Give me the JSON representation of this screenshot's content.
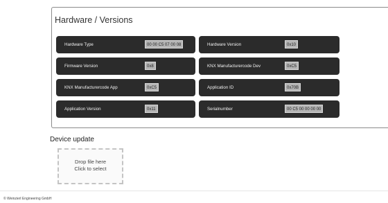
{
  "hardware_panel": {
    "title": "Hardware / Versions",
    "items": [
      {
        "label": "Hardware Type",
        "value": "00 00 C5 07 00 08"
      },
      {
        "label": "Hardware Version",
        "value": "0x10"
      },
      {
        "label": "Firmware Version",
        "value": "0x8"
      },
      {
        "label": "KNX Manufacturercode Dev",
        "value": "0xC5"
      },
      {
        "label": "KNX Manufacturercode App",
        "value": "0xC5"
      },
      {
        "label": "Application ID",
        "value": "0x70B"
      },
      {
        "label": "Application Version",
        "value": "0x11"
      },
      {
        "label": "Serialnumber",
        "value": "00 C5 00 00 00 00"
      }
    ]
  },
  "device_update": {
    "heading": "Device update",
    "dropzone_line1": "Drop file here",
    "dropzone_line2": "Click to select"
  },
  "footer": {
    "copyright": "© Weinzierl Engineering GmbH"
  }
}
